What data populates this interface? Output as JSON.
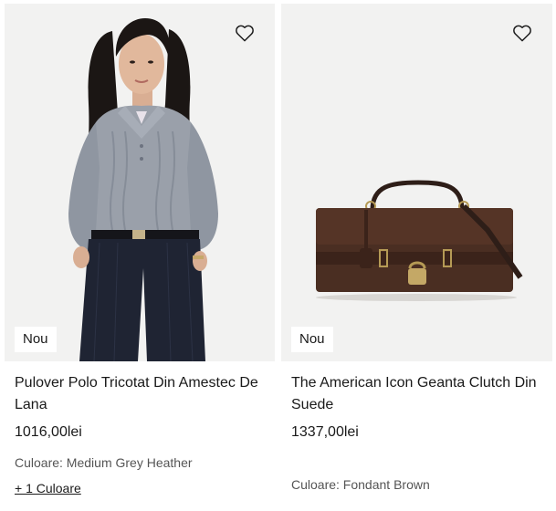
{
  "products": [
    {
      "badge": "Nou",
      "title": "Pulover Polo Tricotat Din Amestec De Lana",
      "price": "1016,00lei",
      "color": "Culoare: Medium Grey Heather",
      "more_colors": "+ 1 Culoare",
      "image_icon": "woman-wearing-grey-cable-knit-polo-sweater",
      "favorite_icon": "heart-outline-icon"
    },
    {
      "badge": "Nou",
      "title": "The American Icon Geanta Clutch Din Suede",
      "price": "1337,00lei",
      "color": "Culoare: Fondant Brown",
      "image_icon": "brown-suede-clutch-bag",
      "favorite_icon": "heart-outline-icon"
    }
  ],
  "colors": {
    "image_background": "#f2f2f1",
    "sweater_grey": "#9aa0aa",
    "trousers_navy": "#1f2433",
    "bag_brown": "#4a2e22"
  }
}
